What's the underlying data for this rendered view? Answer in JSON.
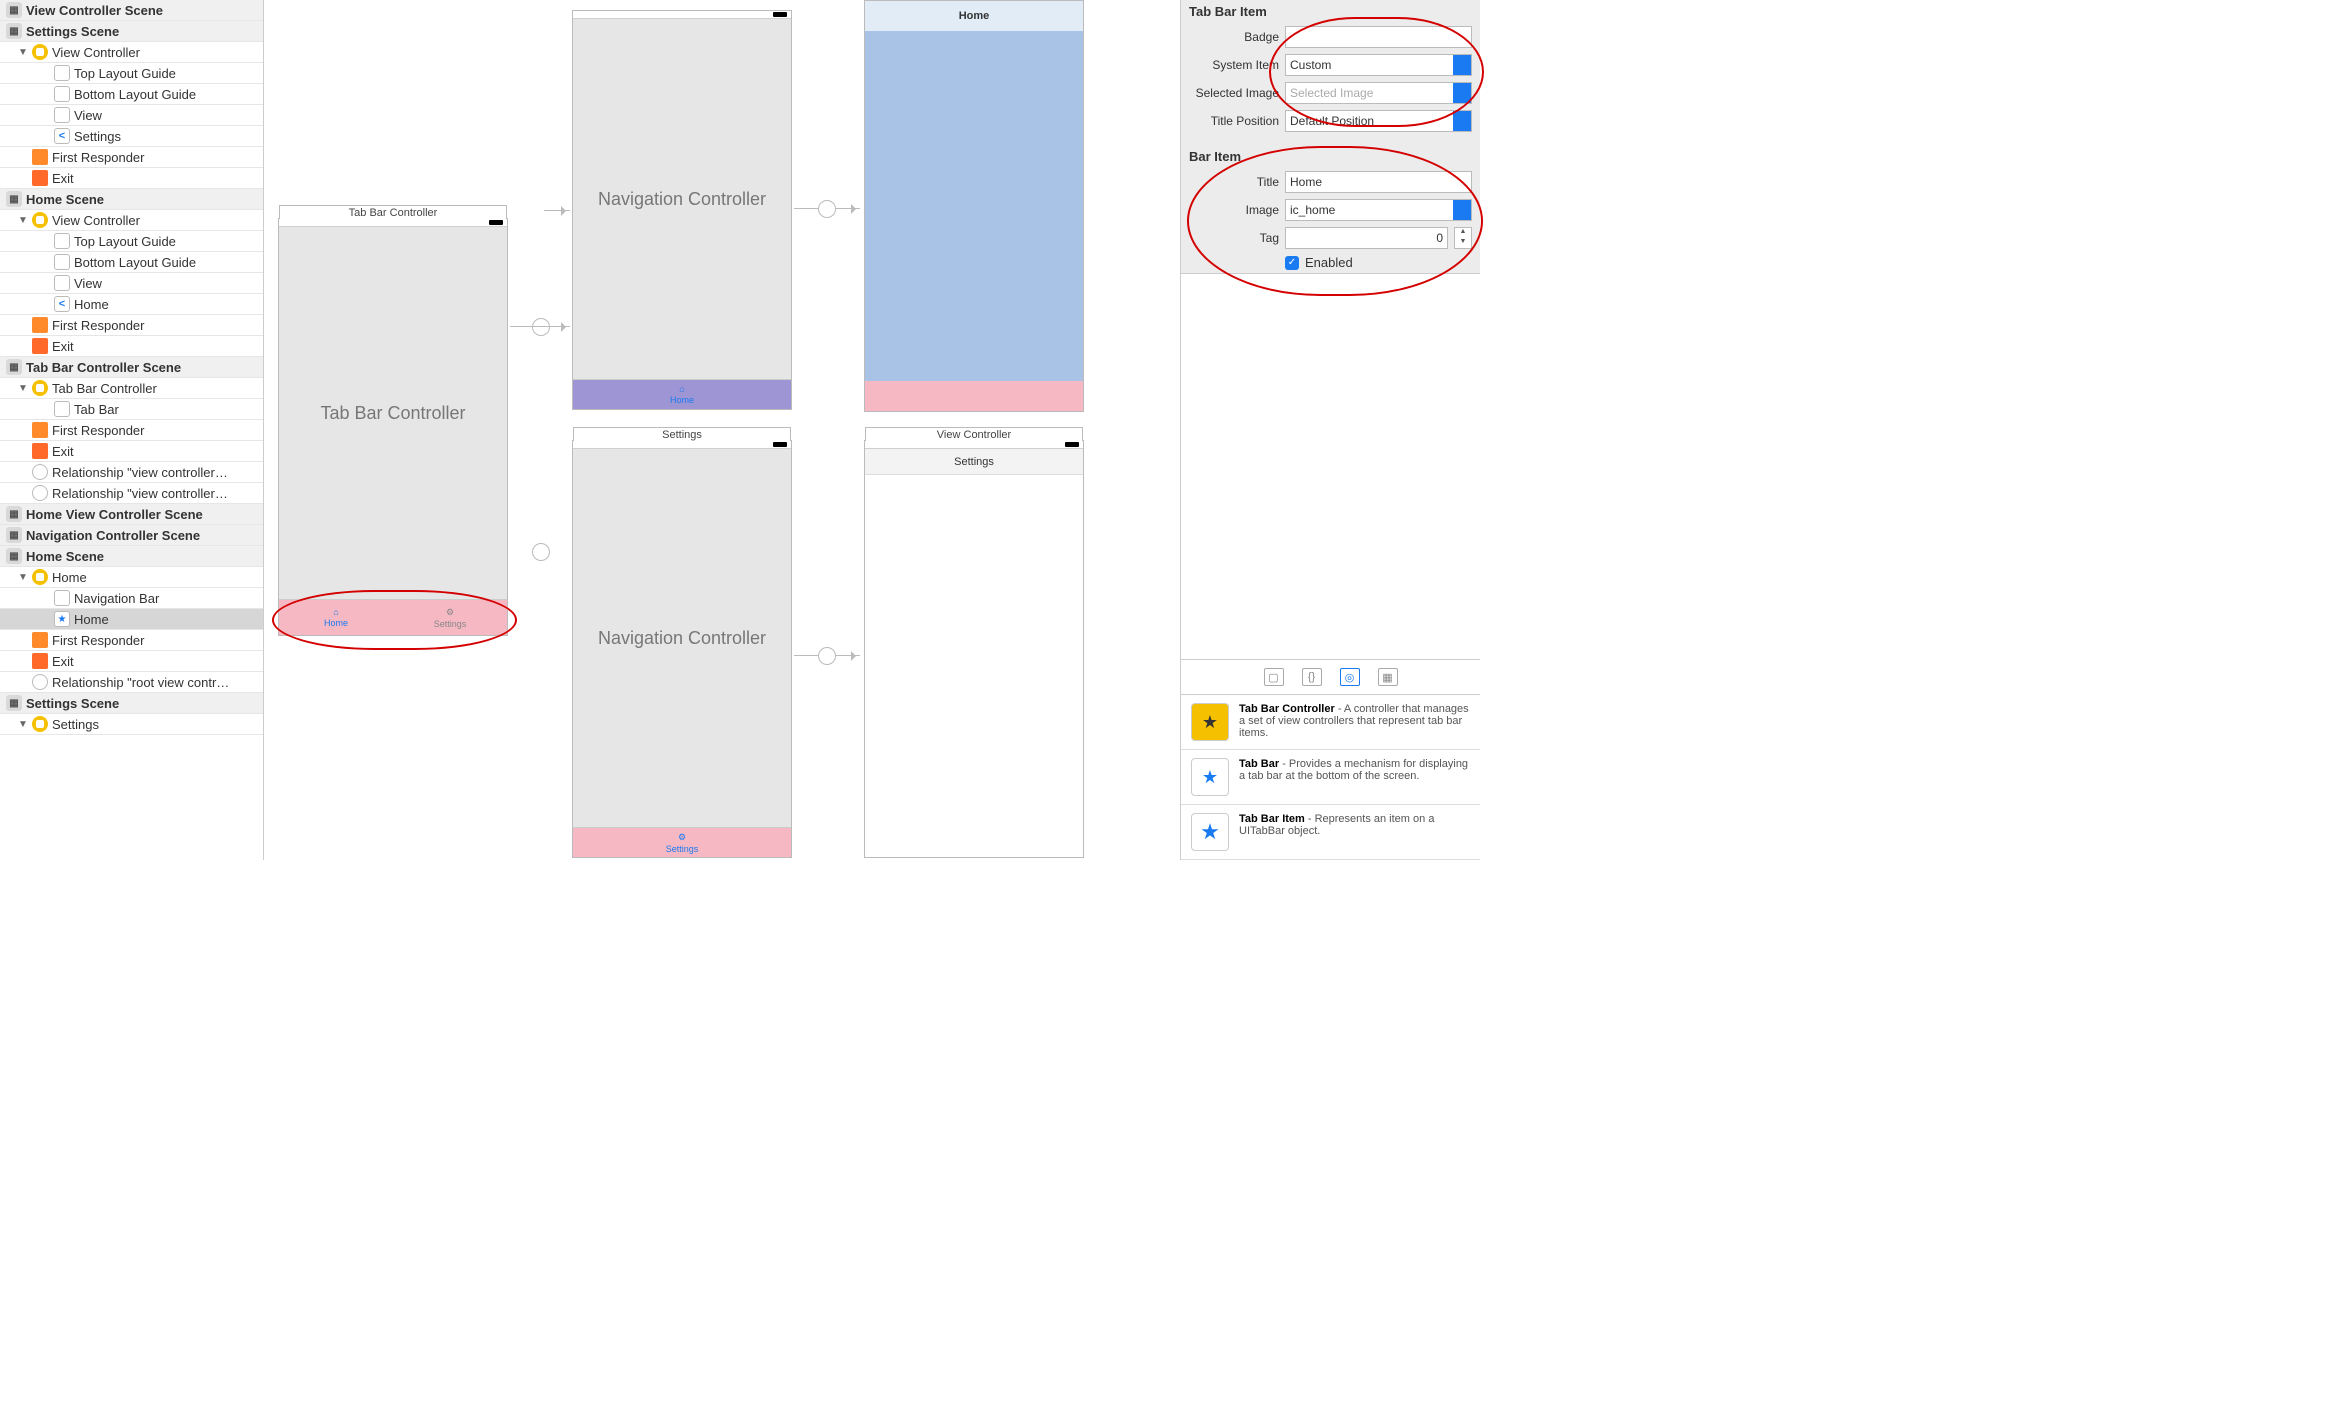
{
  "outline": [
    {
      "type": "scene",
      "label": "View Controller Scene"
    },
    {
      "type": "scene",
      "label": "Settings Scene"
    },
    {
      "type": "vc",
      "indent": 1,
      "disc": "open",
      "label": "View Controller",
      "icon": "vc-yellow"
    },
    {
      "type": "item",
      "indent": 2,
      "label": "Top Layout Guide",
      "icon": "doc"
    },
    {
      "type": "item",
      "indent": 2,
      "label": "Bottom Layout Guide",
      "icon": "doc"
    },
    {
      "type": "item",
      "indent": 2,
      "label": "View",
      "icon": "doc"
    },
    {
      "type": "item",
      "indent": 2,
      "label": "Settings",
      "icon": "back"
    },
    {
      "type": "item",
      "indent": 1,
      "label": "First Responder",
      "icon": "cube"
    },
    {
      "type": "item",
      "indent": 1,
      "label": "Exit",
      "icon": "exit"
    },
    {
      "type": "scene",
      "label": "Home Scene"
    },
    {
      "type": "vc",
      "indent": 1,
      "disc": "open",
      "label": "View Controller",
      "icon": "vc-yellow"
    },
    {
      "type": "item",
      "indent": 2,
      "label": "Top Layout Guide",
      "icon": "doc"
    },
    {
      "type": "item",
      "indent": 2,
      "label": "Bottom Layout Guide",
      "icon": "doc"
    },
    {
      "type": "item",
      "indent": 2,
      "label": "View",
      "icon": "doc"
    },
    {
      "type": "item",
      "indent": 2,
      "label": "Home",
      "icon": "back"
    },
    {
      "type": "item",
      "indent": 1,
      "label": "First Responder",
      "icon": "cube"
    },
    {
      "type": "item",
      "indent": 1,
      "label": "Exit",
      "icon": "exit"
    },
    {
      "type": "scene",
      "label": "Tab Bar Controller Scene"
    },
    {
      "type": "vc",
      "indent": 1,
      "disc": "open",
      "label": "Tab Bar Controller",
      "icon": "vc-yellow"
    },
    {
      "type": "item",
      "indent": 2,
      "label": "Tab Bar",
      "icon": "doc"
    },
    {
      "type": "item",
      "indent": 1,
      "label": "First Responder",
      "icon": "cube"
    },
    {
      "type": "item",
      "indent": 1,
      "label": "Exit",
      "icon": "exit"
    },
    {
      "type": "item",
      "indent": 1,
      "label": "Relationship \"view controller…",
      "icon": "circle"
    },
    {
      "type": "item",
      "indent": 1,
      "label": "Relationship \"view controller…",
      "icon": "circle"
    },
    {
      "type": "scene",
      "label": "Home View Controller Scene"
    },
    {
      "type": "scene",
      "label": "Navigation Controller Scene"
    },
    {
      "type": "scene",
      "label": "Home Scene"
    },
    {
      "type": "vc",
      "indent": 1,
      "disc": "open",
      "label": "Home",
      "icon": "vc-yellow"
    },
    {
      "type": "item",
      "indent": 2,
      "label": "Navigation Bar",
      "icon": "doc"
    },
    {
      "type": "item",
      "indent": 2,
      "label": "Home",
      "icon": "star",
      "selected": true
    },
    {
      "type": "item",
      "indent": 1,
      "label": "First Responder",
      "icon": "cube"
    },
    {
      "type": "item",
      "indent": 1,
      "label": "Exit",
      "icon": "exit"
    },
    {
      "type": "item",
      "indent": 1,
      "label": "Relationship \"root view contr…",
      "icon": "circle"
    },
    {
      "type": "scene",
      "label": "Settings Scene"
    },
    {
      "type": "vc",
      "indent": 1,
      "disc": "open",
      "label": "Settings",
      "icon": "vc-yellow",
      "cut": true
    }
  ],
  "canvas": {
    "tabbarController": {
      "title": "Tab Bar Controller",
      "bodyText": "Tab Bar Controller",
      "tabs": [
        {
          "label": "Home",
          "active": true
        },
        {
          "label": "Settings",
          "active": false
        }
      ]
    },
    "nav1": {
      "bodyText": "Navigation Controller",
      "tabLabel": "Home"
    },
    "home": {
      "navTitle": "Home"
    },
    "nav2": {
      "title": "Settings",
      "bodyText": "Navigation Controller",
      "tabLabel": "Settings"
    },
    "vc2": {
      "title": "View Controller",
      "navTitle": "Settings"
    }
  },
  "inspector": {
    "tabBarItem": {
      "sectionTitle": "Tab Bar Item",
      "badgeLabel": "Badge",
      "badgeValue": "",
      "systemItemLabel": "System Item",
      "systemItemValue": "Custom",
      "selectedImageLabel": "Selected Image",
      "selectedImagePlaceholder": "Selected Image",
      "titlePositionLabel": "Title Position",
      "titlePositionValue": "Default Position"
    },
    "barItem": {
      "sectionTitle": "Bar Item",
      "titleLabel": "Title",
      "titleValue": "Home",
      "imageLabel": "Image",
      "imageValue": "ic_home",
      "tagLabel": "Tag",
      "tagValue": "0",
      "enabledLabel": "Enabled",
      "enabledChecked": true
    },
    "library": [
      {
        "title": "Tab Bar Controller",
        "desc": " - A controller that manages a set of view controllers that represent tab bar items.",
        "iconColor": "#f5c000"
      },
      {
        "title": "Tab Bar",
        "desc": " - Provides a mechanism for displaying a tab bar at the bottom of the screen.",
        "iconColor": "#1a7af1"
      },
      {
        "title": "Tab Bar Item",
        "desc": " - Represents an item on a UITabBar object.",
        "iconColor": "#1a7af1"
      }
    ]
  }
}
